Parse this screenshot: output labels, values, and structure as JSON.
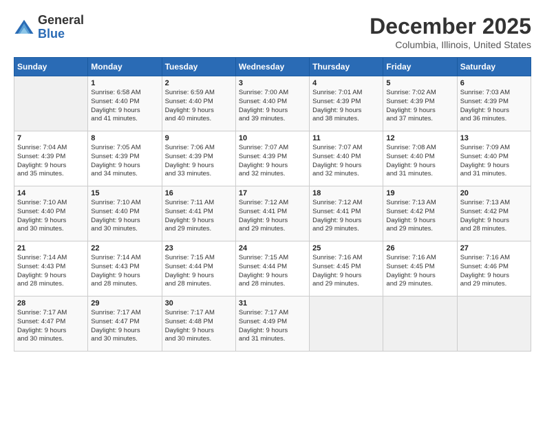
{
  "header": {
    "logo_general": "General",
    "logo_blue": "Blue",
    "month_title": "December 2025",
    "location": "Columbia, Illinois, United States"
  },
  "days_of_week": [
    "Sunday",
    "Monday",
    "Tuesday",
    "Wednesday",
    "Thursday",
    "Friday",
    "Saturday"
  ],
  "weeks": [
    [
      {
        "day": "",
        "info": ""
      },
      {
        "day": "1",
        "info": "Sunrise: 6:58 AM\nSunset: 4:40 PM\nDaylight: 9 hours\nand 41 minutes."
      },
      {
        "day": "2",
        "info": "Sunrise: 6:59 AM\nSunset: 4:40 PM\nDaylight: 9 hours\nand 40 minutes."
      },
      {
        "day": "3",
        "info": "Sunrise: 7:00 AM\nSunset: 4:40 PM\nDaylight: 9 hours\nand 39 minutes."
      },
      {
        "day": "4",
        "info": "Sunrise: 7:01 AM\nSunset: 4:39 PM\nDaylight: 9 hours\nand 38 minutes."
      },
      {
        "day": "5",
        "info": "Sunrise: 7:02 AM\nSunset: 4:39 PM\nDaylight: 9 hours\nand 37 minutes."
      },
      {
        "day": "6",
        "info": "Sunrise: 7:03 AM\nSunset: 4:39 PM\nDaylight: 9 hours\nand 36 minutes."
      }
    ],
    [
      {
        "day": "7",
        "info": "Sunrise: 7:04 AM\nSunset: 4:39 PM\nDaylight: 9 hours\nand 35 minutes."
      },
      {
        "day": "8",
        "info": "Sunrise: 7:05 AM\nSunset: 4:39 PM\nDaylight: 9 hours\nand 34 minutes."
      },
      {
        "day": "9",
        "info": "Sunrise: 7:06 AM\nSunset: 4:39 PM\nDaylight: 9 hours\nand 33 minutes."
      },
      {
        "day": "10",
        "info": "Sunrise: 7:07 AM\nSunset: 4:39 PM\nDaylight: 9 hours\nand 32 minutes."
      },
      {
        "day": "11",
        "info": "Sunrise: 7:07 AM\nSunset: 4:40 PM\nDaylight: 9 hours\nand 32 minutes."
      },
      {
        "day": "12",
        "info": "Sunrise: 7:08 AM\nSunset: 4:40 PM\nDaylight: 9 hours\nand 31 minutes."
      },
      {
        "day": "13",
        "info": "Sunrise: 7:09 AM\nSunset: 4:40 PM\nDaylight: 9 hours\nand 31 minutes."
      }
    ],
    [
      {
        "day": "14",
        "info": "Sunrise: 7:10 AM\nSunset: 4:40 PM\nDaylight: 9 hours\nand 30 minutes."
      },
      {
        "day": "15",
        "info": "Sunrise: 7:10 AM\nSunset: 4:40 PM\nDaylight: 9 hours\nand 30 minutes."
      },
      {
        "day": "16",
        "info": "Sunrise: 7:11 AM\nSunset: 4:41 PM\nDaylight: 9 hours\nand 29 minutes."
      },
      {
        "day": "17",
        "info": "Sunrise: 7:12 AM\nSunset: 4:41 PM\nDaylight: 9 hours\nand 29 minutes."
      },
      {
        "day": "18",
        "info": "Sunrise: 7:12 AM\nSunset: 4:41 PM\nDaylight: 9 hours\nand 29 minutes."
      },
      {
        "day": "19",
        "info": "Sunrise: 7:13 AM\nSunset: 4:42 PM\nDaylight: 9 hours\nand 29 minutes."
      },
      {
        "day": "20",
        "info": "Sunrise: 7:13 AM\nSunset: 4:42 PM\nDaylight: 9 hours\nand 28 minutes."
      }
    ],
    [
      {
        "day": "21",
        "info": "Sunrise: 7:14 AM\nSunset: 4:43 PM\nDaylight: 9 hours\nand 28 minutes."
      },
      {
        "day": "22",
        "info": "Sunrise: 7:14 AM\nSunset: 4:43 PM\nDaylight: 9 hours\nand 28 minutes."
      },
      {
        "day": "23",
        "info": "Sunrise: 7:15 AM\nSunset: 4:44 PM\nDaylight: 9 hours\nand 28 minutes."
      },
      {
        "day": "24",
        "info": "Sunrise: 7:15 AM\nSunset: 4:44 PM\nDaylight: 9 hours\nand 28 minutes."
      },
      {
        "day": "25",
        "info": "Sunrise: 7:16 AM\nSunset: 4:45 PM\nDaylight: 9 hours\nand 29 minutes."
      },
      {
        "day": "26",
        "info": "Sunrise: 7:16 AM\nSunset: 4:45 PM\nDaylight: 9 hours\nand 29 minutes."
      },
      {
        "day": "27",
        "info": "Sunrise: 7:16 AM\nSunset: 4:46 PM\nDaylight: 9 hours\nand 29 minutes."
      }
    ],
    [
      {
        "day": "28",
        "info": "Sunrise: 7:17 AM\nSunset: 4:47 PM\nDaylight: 9 hours\nand 30 minutes."
      },
      {
        "day": "29",
        "info": "Sunrise: 7:17 AM\nSunset: 4:47 PM\nDaylight: 9 hours\nand 30 minutes."
      },
      {
        "day": "30",
        "info": "Sunrise: 7:17 AM\nSunset: 4:48 PM\nDaylight: 9 hours\nand 30 minutes."
      },
      {
        "day": "31",
        "info": "Sunrise: 7:17 AM\nSunset: 4:49 PM\nDaylight: 9 hours\nand 31 minutes."
      },
      {
        "day": "",
        "info": ""
      },
      {
        "day": "",
        "info": ""
      },
      {
        "day": "",
        "info": ""
      }
    ]
  ]
}
